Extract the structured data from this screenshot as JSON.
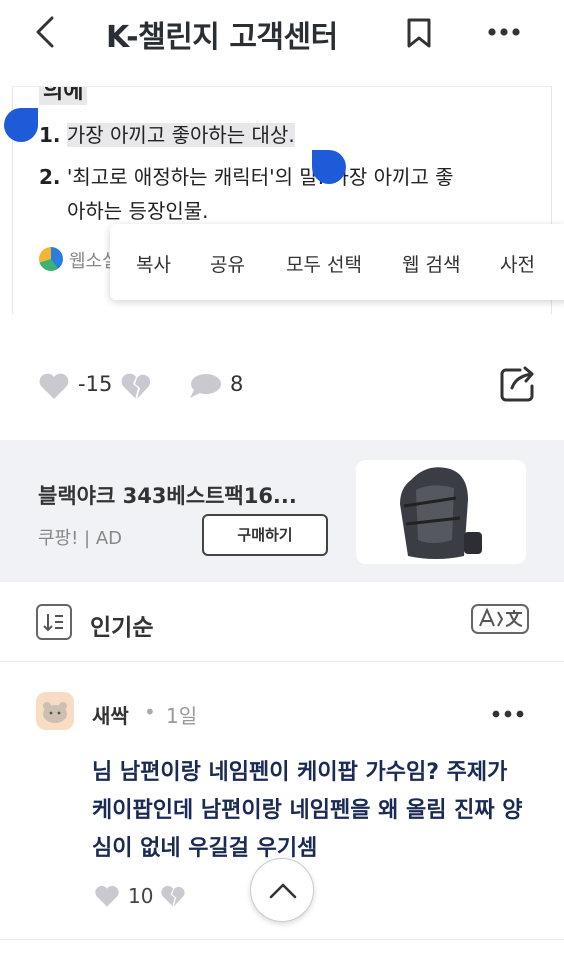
{
  "header": {
    "title": "K-챌린지 고객센터",
    "back_icon": "chevron-left-icon",
    "bookmark_icon": "bookmark-icon",
    "more_icon": "more-horizontal-icon"
  },
  "snippet": {
    "cut_heading": "의에",
    "definitions": [
      {
        "num": "1.",
        "text": "가장 아끼고 좋아하는 대상."
      },
      {
        "num": "2.",
        "text": "'최고로 애정하는 캐릭터'의 말. 가장 아끼고 좋",
        "cont": "아하는 등장인물."
      }
    ],
    "source_label": "웹소설"
  },
  "context_menu": {
    "items": [
      "복사",
      "공유",
      "모두 선택",
      "웹 검색",
      "사전"
    ]
  },
  "reactions": {
    "like_count": "-15",
    "comment_count": "8"
  },
  "ad": {
    "title": "블랙야크 343베스트팩16...",
    "sub": "쿠팡! | AD",
    "buy_label": "구매하기"
  },
  "sort": {
    "label": "인기순",
    "translate_icon": "translate-icon"
  },
  "comment": {
    "author": "새싹",
    "separator": "•",
    "time": "1일",
    "text": "님 남편이랑 네임펜이 케이팝 가수임? 주제가 케이팝인데 남편이랑 네임펜을 왜 올림 진짜 양심이 없네 우길걸 우기셈",
    "like_count": "10"
  },
  "colors": {
    "accent_blue": "#1e5bd8",
    "ad_bg": "#f1f2f6",
    "comment_text": "#1b2a55"
  }
}
